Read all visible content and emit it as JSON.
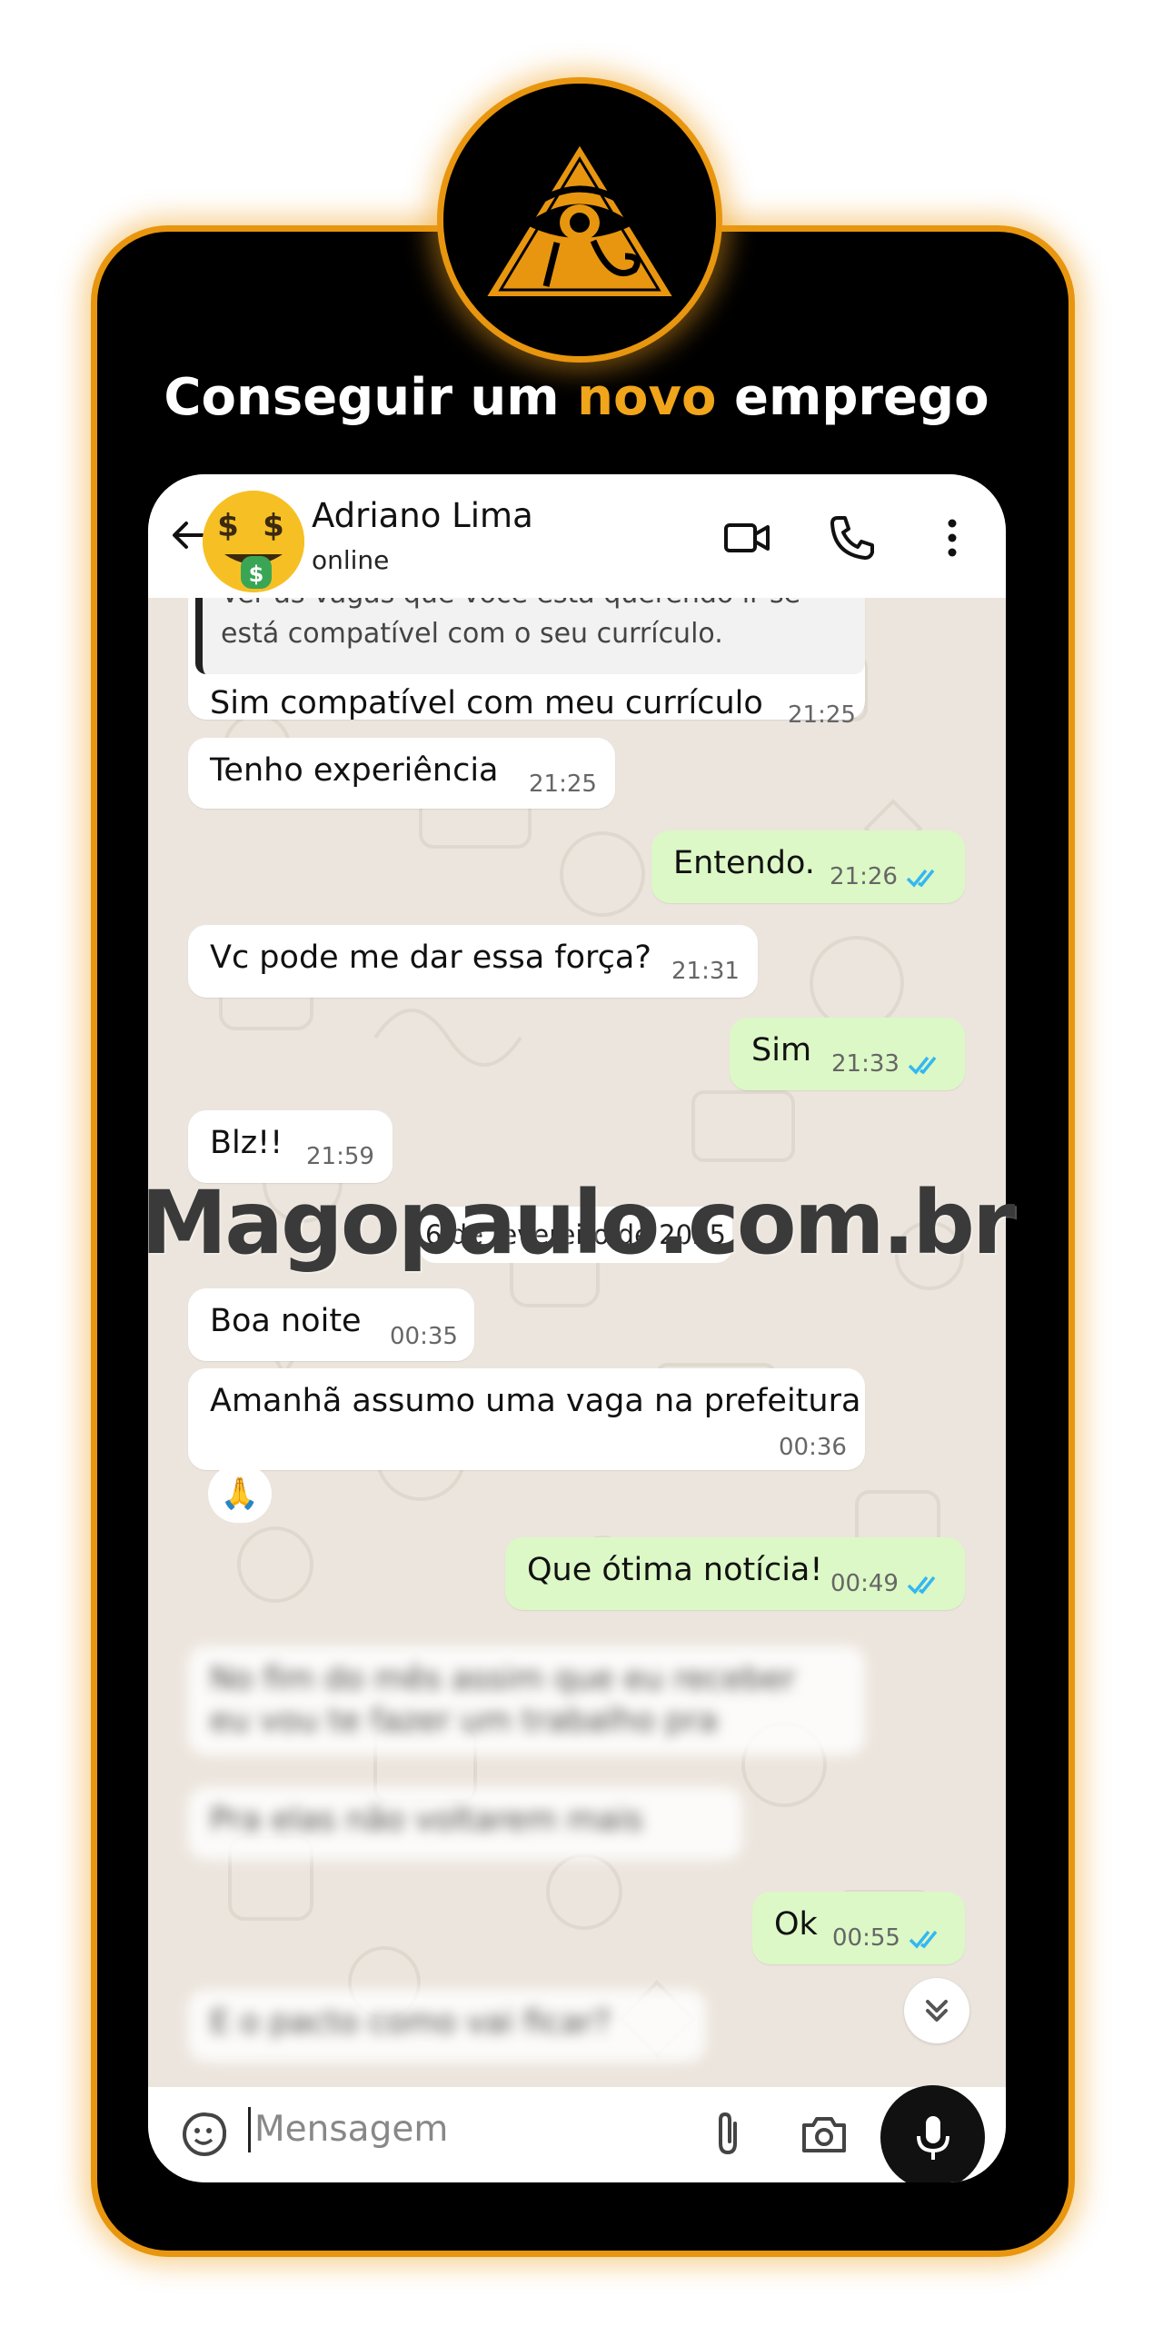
{
  "headline": {
    "part1": "Conseguir um ",
    "highlight": "novo",
    "part2": " emprego"
  },
  "contact": {
    "name": "Adriano Lima",
    "status": "online",
    "avatar_icon": "money-mouth-face-icon"
  },
  "messages": [
    {
      "text": "Sim compatível com meu currículo",
      "time": "21:25",
      "direction": "in"
    },
    {
      "text": "Tenho experiência",
      "time": "21:25",
      "direction": "in"
    },
    {
      "text": "Entendo.",
      "time": "21:26",
      "direction": "out"
    },
    {
      "text": "Vc pode me dar essa força?",
      "time": "21:31",
      "direction": "in"
    },
    {
      "text": "Sim",
      "time": "21:33",
      "direction": "out"
    },
    {
      "text": "Blz!!",
      "time": "21:59",
      "direction": "in"
    },
    {
      "text": "Boa noite",
      "time": "00:35",
      "direction": "in"
    },
    {
      "text": "Amanhã assumo uma vaga na prefeitura",
      "time": "00:36",
      "direction": "in"
    },
    {
      "text": "Que ótima notícia!",
      "time": "00:49",
      "direction": "out"
    },
    {
      "text": "Ok",
      "time": "00:55",
      "direction": "out"
    }
  ],
  "quoted": {
    "line1": "Ver as vagas que você está querendo ir se",
    "line2": "está compatível com o seu currículo."
  },
  "blurred_messages": [
    "No fim do mês assim que eu receber",
    "eu vou te fazer um trabalho pra",
    "Pra elas não voltarem mais",
    "E o pacto como vai ficar?"
  ],
  "date_separator": "6 de fevereiro de 2025",
  "reaction_emoji": "🙏",
  "watermark": "Magopaulo.com.br",
  "input": {
    "placeholder": "Mensagem"
  },
  "colors": {
    "accent": "#e8960f",
    "outgoing": "#dcf8c6",
    "tick_blue": "#34b7f1"
  }
}
